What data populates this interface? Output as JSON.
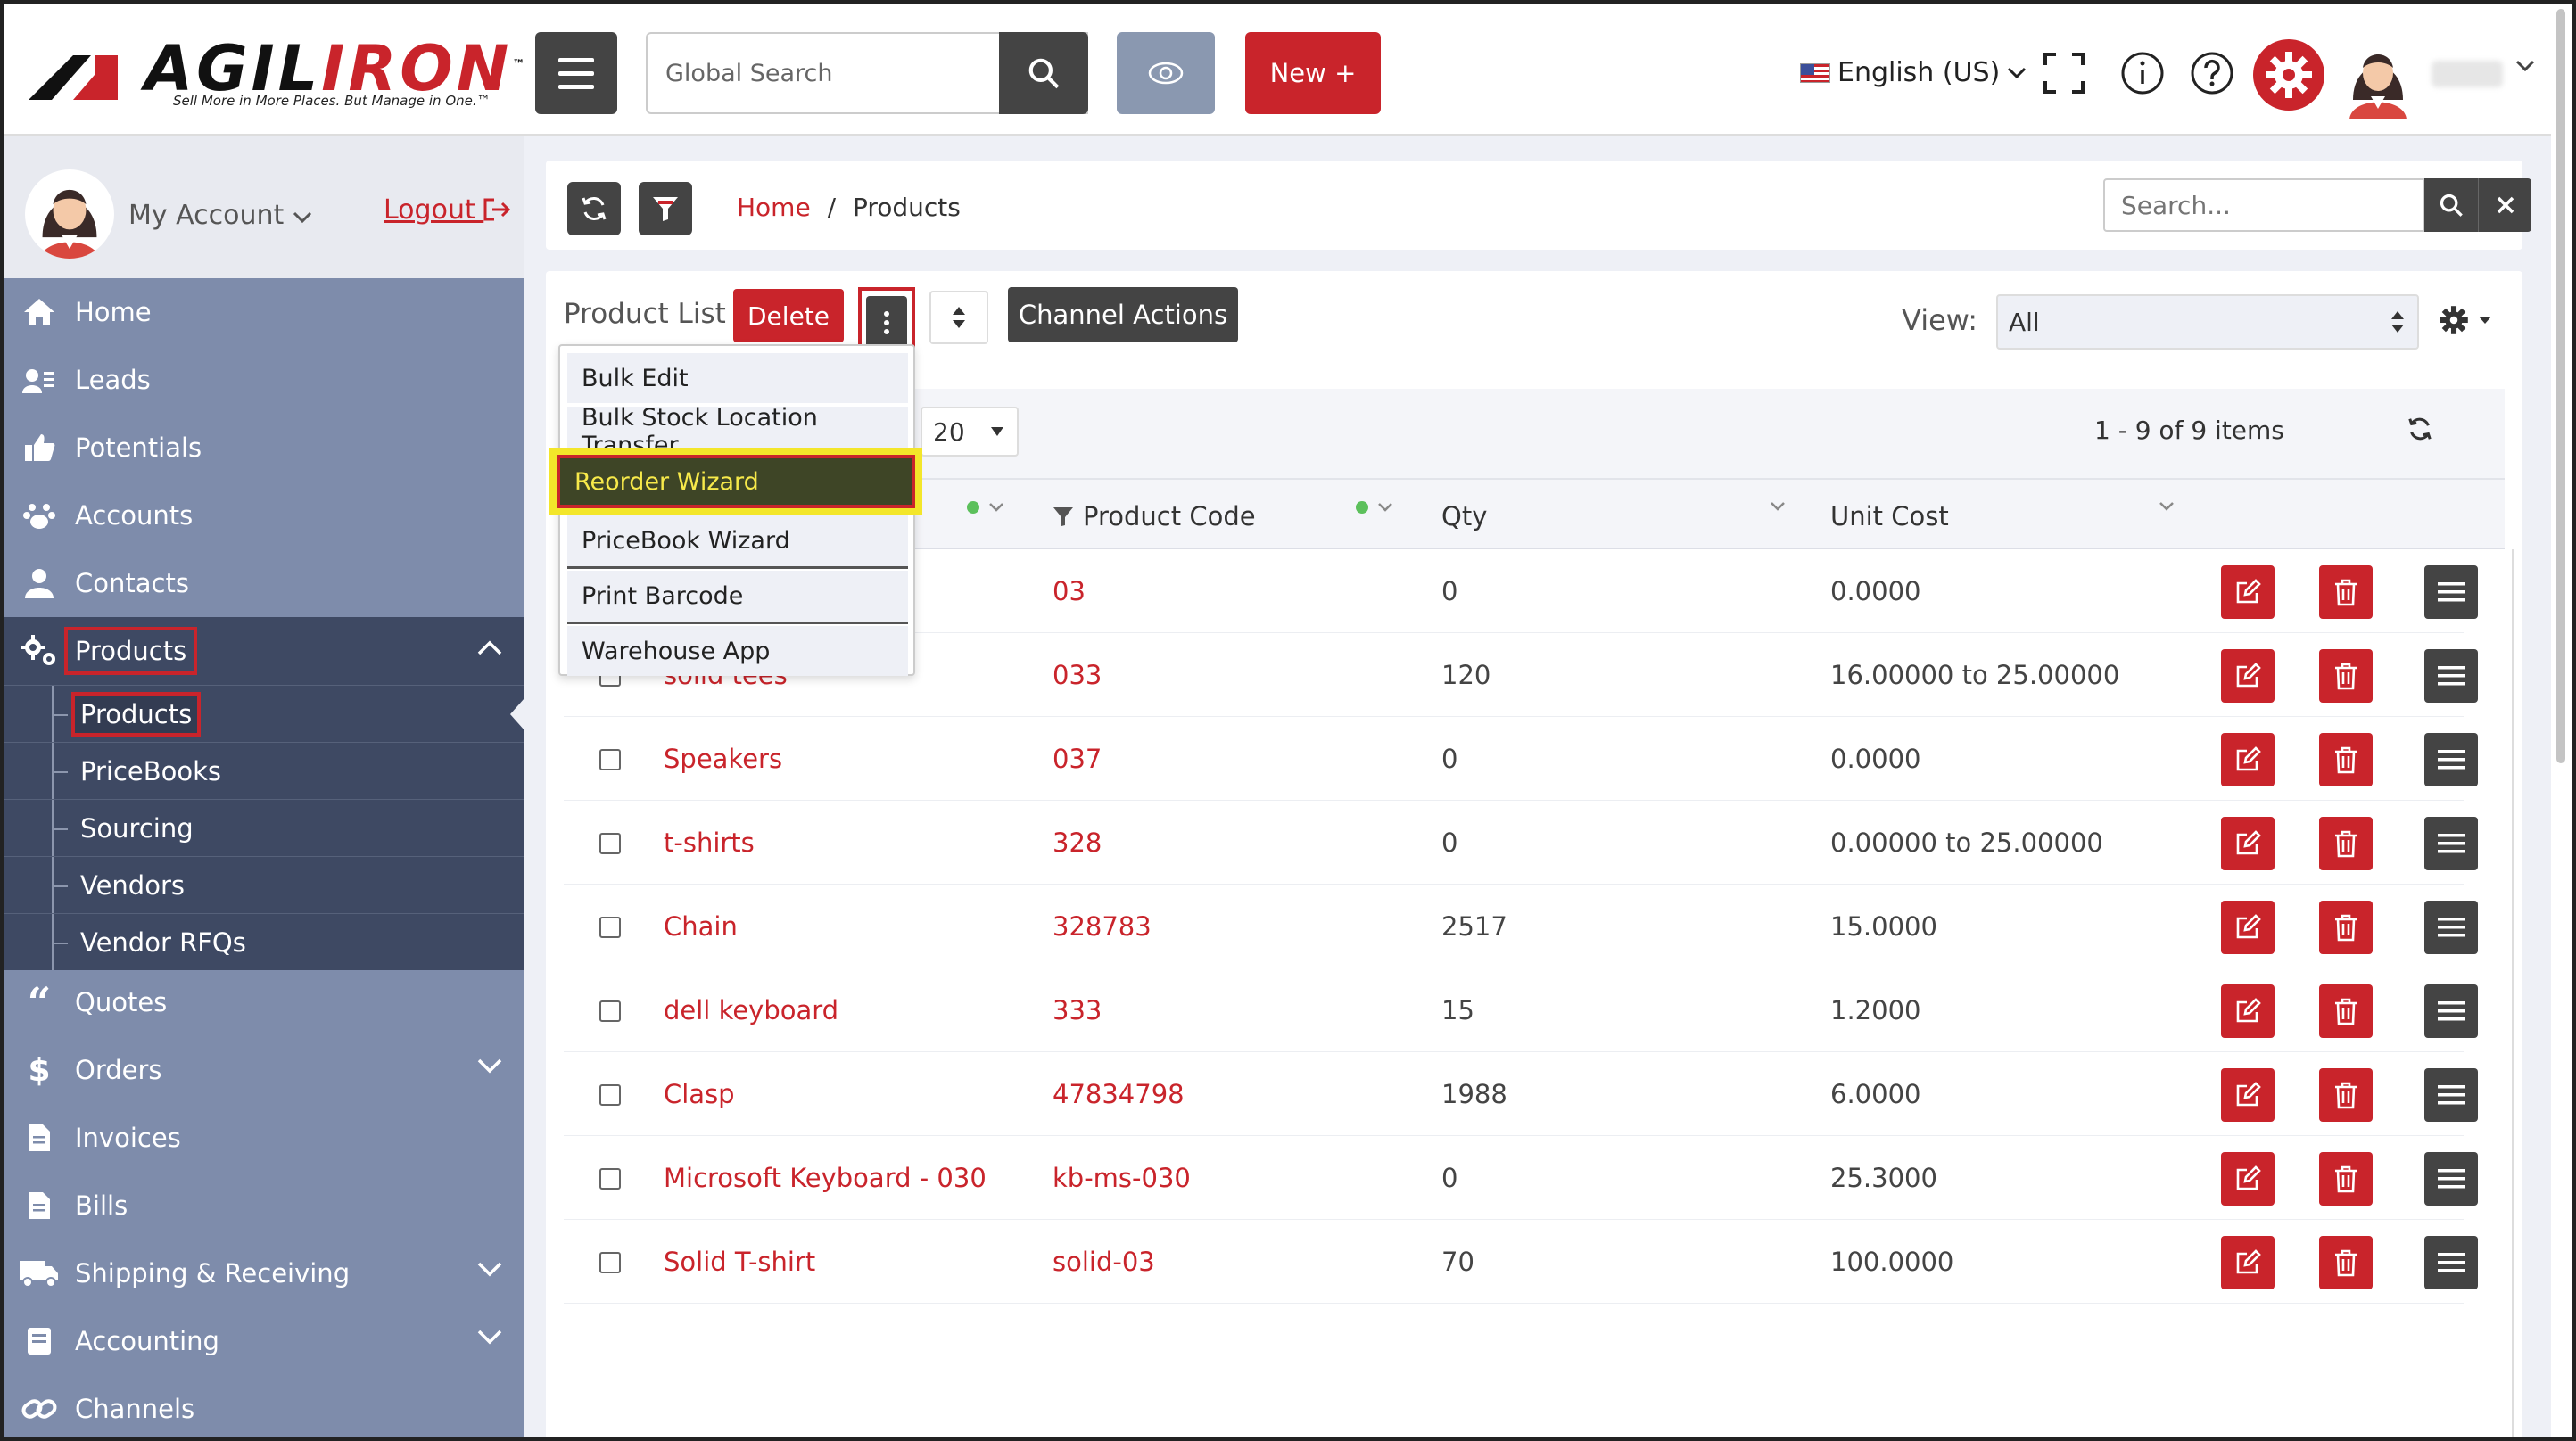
{
  "header": {
    "brand_prefix": "AGIL",
    "brand_suffix": "IRON",
    "trademark": "™",
    "tagline": "Sell More in More Places. But Manage in One.™",
    "search_placeholder": "Global Search",
    "new_label": "New +",
    "language": "English (US)",
    "icons": [
      "menu-icon",
      "search-icon",
      "eye-icon",
      "fullscreen-icon",
      "info-icon",
      "help-icon",
      "gear-icon",
      "avatar",
      "chevron-down-icon"
    ]
  },
  "sidebar": {
    "my_account": "My Account",
    "logout": "Logout",
    "items": [
      {
        "label": "Home",
        "icon": "home-icon"
      },
      {
        "label": "Leads",
        "icon": "leads-icon"
      },
      {
        "label": "Potentials",
        "icon": "thumbs-up-icon"
      },
      {
        "label": "Accounts",
        "icon": "paw-icon"
      },
      {
        "label": "Contacts",
        "icon": "person-icon"
      },
      {
        "label": "Products",
        "icon": "gears-icon"
      },
      {
        "label": "Quotes",
        "icon": "quote-icon"
      },
      {
        "label": "Orders",
        "icon": "dollar-icon"
      },
      {
        "label": "Invoices",
        "icon": "document-icon"
      },
      {
        "label": "Bills",
        "icon": "document-icon"
      },
      {
        "label": "Shipping & Receiving",
        "icon": "truck-icon"
      },
      {
        "label": "Accounting",
        "icon": "book-icon"
      },
      {
        "label": "Channels",
        "icon": "link-icon"
      }
    ],
    "products_sub": [
      "Products",
      "PriceBooks",
      "Sourcing",
      "Vendors",
      "Vendor RFQs"
    ]
  },
  "breadcrumb": {
    "home": "Home",
    "separator": "/",
    "current": "Products"
  },
  "search": {
    "placeholder": "Search..."
  },
  "toolbar": {
    "title": "Product List",
    "delete": "Delete",
    "channel_actions": "Channel Actions",
    "view_label": "View:",
    "view_value": "All"
  },
  "dropdown": {
    "items": [
      "Bulk Edit",
      "Bulk Stock Location Transfer",
      "Reorder Wizard",
      "PriceBook Wizard",
      "Print Barcode",
      "Warehouse App"
    ],
    "highlighted": "Reorder Wizard"
  },
  "list": {
    "per_page_partial": "20",
    "count": "1 - 9 of 9 items",
    "columns": [
      "Product Code",
      "Qty",
      "Unit Cost"
    ],
    "rows": [
      {
        "name": "",
        "code": "03",
        "qty": "0",
        "cost": "0.0000"
      },
      {
        "name": "solid tees",
        "code": "033",
        "qty": "120",
        "cost": "16.00000 to 25.00000"
      },
      {
        "name": "Speakers",
        "code": "037",
        "qty": "0",
        "cost": "0.0000"
      },
      {
        "name": "t-shirts",
        "code": "328",
        "qty": "0",
        "cost": "0.00000 to 25.00000"
      },
      {
        "name": "Chain",
        "code": "328783",
        "qty": "2517",
        "cost": "15.0000"
      },
      {
        "name": "dell keyboard",
        "code": "333",
        "qty": "15",
        "cost": "1.2000"
      },
      {
        "name": "Clasp",
        "code": "47834798",
        "qty": "1988",
        "cost": "6.0000"
      },
      {
        "name": "Microsoft Keyboard - 030",
        "code": "kb-ms-030",
        "qty": "0",
        "cost": "25.3000"
      },
      {
        "name": "Solid T-shirt",
        "code": "solid-03",
        "qty": "70",
        "cost": "100.0000"
      }
    ]
  },
  "colors": {
    "accent": "#c9242b",
    "dark": "#444444",
    "sidebar": "#7e8cab",
    "sidebar_active": "#3e4963",
    "highlight": "#f3e62a"
  }
}
